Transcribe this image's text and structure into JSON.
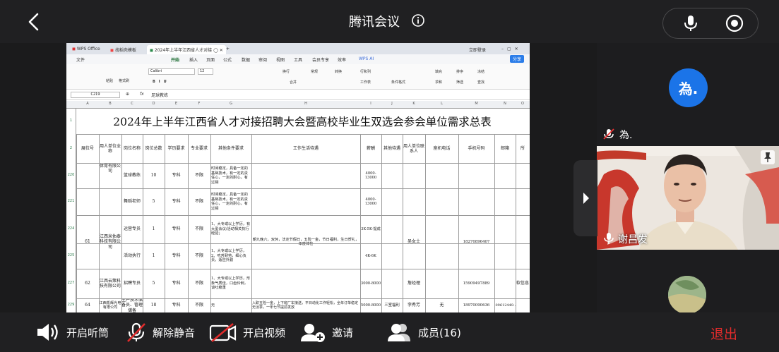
{
  "topbar": {
    "title": "腾讯会议",
    "info_icon": "info-icon",
    "back_icon": "chevron-left-icon",
    "mic_icon": "microphone-icon",
    "record_icon": "record-icon"
  },
  "wps": {
    "tabs": [
      {
        "label": "WPS Office",
        "active": false
      },
      {
        "label": "找稻壳模板",
        "active": false
      },
      {
        "label": "2024年上半年江西省人才对接 ◯",
        "active": true
      }
    ],
    "new_tab": "+",
    "menu": [
      "文件",
      "开始",
      "插入",
      "页面",
      "公式",
      "数据",
      "审阅",
      "视图",
      "工具",
      "会员专享",
      "效率",
      "WPS AI"
    ],
    "active_menu": "开始",
    "share_label": "分享",
    "user_label": "立即登录",
    "ribbon": {
      "paste": "粘贴",
      "format_painter": "格式刷",
      "font": "Calibri",
      "font_size": "12",
      "wrap": "换行",
      "merge": "合并",
      "normal": "常规",
      "convert": "转换",
      "row_col": "行和列",
      "worksheet": "工作表",
      "cond_format": "条件格式",
      "fill": "填充",
      "sort": "排序",
      "freeze": "冻结",
      "sum": "求和",
      "filter": "筛选",
      "find": "查找"
    },
    "cell_ref": "C219",
    "fx": "fx",
    "formula": "足球教练",
    "columns": [
      "A",
      "B",
      "C",
      "D",
      "E",
      "F",
      "G",
      "H",
      "I",
      "J",
      "K",
      "L",
      "M",
      "N",
      "O"
    ]
  },
  "sheet": {
    "title": "2024年上半年江西省人才对接招聘大会暨高校毕业生双选会参会单位需求总表",
    "title_row": "1",
    "header_row": "2",
    "headers": [
      "展位号",
      "用人单位全称",
      "岗位名称",
      "岗位总数",
      "学历要求",
      "专业要求",
      "其他条件要求",
      "工作生活待遇",
      "薪酬",
      "其他待遇",
      "用人单位联系人",
      "座机电话",
      "手机号码",
      "邮箱",
      "所"
    ],
    "rows": [
      {
        "rownum": "220",
        "booth": "",
        "company": "体育有限公司",
        "position": "篮球教练",
        "count": "10",
        "edu": "专科",
        "major": "不限",
        "other": "时间稳定，具备一定的基础技术，有一定的责任心，一定的耐心，有过相",
        "salary": "4000-13000"
      },
      {
        "rownum": "221",
        "position": "舞蹈老师",
        "count": "5",
        "edu": "专科",
        "major": "不限",
        "other": "时间稳定，具备一定的基础技术，有一定的责任心，一定的耐心，有过相",
        "salary": "4000-13000"
      },
      {
        "rownum": "224",
        "booth": "61",
        "company": "江西米佑泰科技有限公司",
        "position": "运营专员",
        "count": "1",
        "edu": "专科",
        "major": "不限",
        "other": "1、大专或以上学历，有大型会议/活动相关执行经验；",
        "welfare": "朝九晚六，双休，法定节假日，五险一金，节日福利，生日贺礼，年度体检",
        "salary": "3K-5K·提成",
        "contact": "吴女士",
        "mobile": "18270896407"
      },
      {
        "rownum": "225",
        "position": "活动执行",
        "count": "1",
        "edu": "专科",
        "major": "不限",
        "other": "1、大专或以上学历，2、吃苦耐劳，细心负责，适应外勤",
        "salary": "4K-6K"
      },
      {
        "rownum": "227",
        "booth": "62",
        "company": "江西云策科技有限公司",
        "position": "招聘专员",
        "count": "5",
        "edu": "专科",
        "major": "不限",
        "other": "1、大专或以上学历，形象气质佳，口齿伶俐，谈吐稳重",
        "salary": "3000-8000",
        "contact": "詹经理",
        "mobile": "15909497889",
        "extra": "软信息"
      },
      {
        "rownum": "229",
        "booth": "64",
        "company": "江西凯辉光电有限公司",
        "position": "生产技术储备员、管理储备",
        "count": "18",
        "edu": "专科",
        "major": "不限",
        "other": "无",
        "welfare": "入职五险一金，上下班厂车接送，平日动化工作轻松，全年订单稳定无淡季，一年七节提前发放",
        "salary": "5000-8000",
        "other_welfare": "三室福利",
        "contact": "李秀芳",
        "phone": "无",
        "mobile": "18970090636",
        "email": "809612449..."
      }
    ]
  },
  "sidebar": {
    "avatar_text": "為.",
    "participant1": "為.",
    "participant2": "谢昌发",
    "muted_icon": "microphone-muted-icon",
    "mic_icon": "microphone-icon",
    "pin_icon": "pin-icon"
  },
  "toolbar": {
    "speaker": "开启听筒",
    "unmute": "解除静音",
    "video": "开启视频",
    "invite": "邀请",
    "members": "成员(16)",
    "leave": "退出"
  },
  "colors": {
    "accent_blue": "#1b74e8",
    "leave_red": "#e02b2b",
    "wps_green": "#1a6b2f"
  }
}
